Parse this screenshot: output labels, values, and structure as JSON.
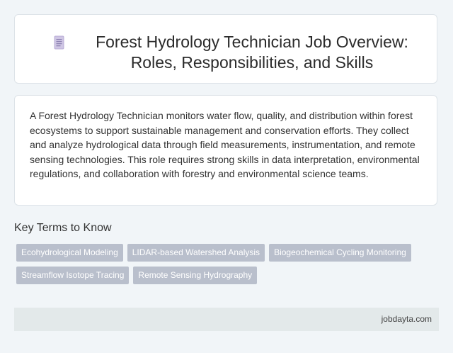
{
  "header": {
    "icon": "document-icon",
    "title": "Forest Hydrology Technician Job Overview: Roles, Responsibilities, and Skills"
  },
  "description": "A Forest Hydrology Technician monitors water flow, quality, and distribution within forest ecosystems to support sustainable management and conservation efforts. They collect and analyze hydrological data through field measurements, instrumentation, and remote sensing technologies. This role requires strong skills in data interpretation, environmental regulations, and collaboration with forestry and environmental science teams.",
  "key_terms": {
    "heading": "Key Terms to Know",
    "tags": [
      "Ecohydrological Modeling",
      "LIDAR-based Watershed Analysis",
      "Biogeochemical Cycling Monitoring",
      "Streamflow Isotope Tracing",
      "Remote Sensing Hydrography"
    ]
  },
  "footer": {
    "brand": "jobdayta.com"
  },
  "colors": {
    "background": "#f1f5f8",
    "card": "#ffffff",
    "tag": "#b9bfcc",
    "footer": "#e3e9ea",
    "icon": "#c9bfe0"
  }
}
